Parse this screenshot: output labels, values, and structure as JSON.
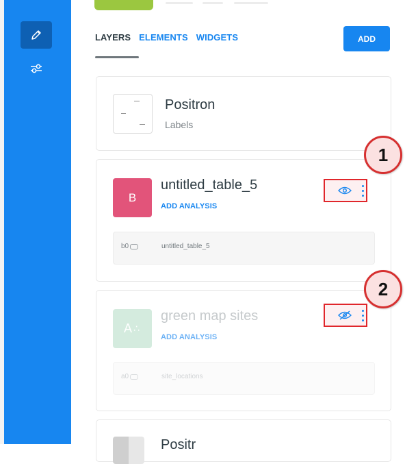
{
  "tabs": {
    "layers": "LAYERS",
    "elements": "ELEMENTS",
    "widgets": "WIDGETS",
    "add_label": "ADD"
  },
  "basemap": {
    "title": "Positron",
    "subtitle": "Labels"
  },
  "layers": [
    {
      "letter": "B",
      "name": "untitled_table_5",
      "add_analysis": "ADD ANALYSIS",
      "node_id": "b0",
      "source": "untitled_table_5",
      "visible": true,
      "color": "#e2547a"
    },
    {
      "letter": "A",
      "name": "green map sites",
      "add_analysis": "ADD ANALYSIS",
      "node_id": "a0",
      "source": "site_locations",
      "visible": false,
      "color": "#d4ebde"
    }
  ],
  "partial_layer": {
    "title": "Positr"
  },
  "callouts": [
    "1",
    "2"
  ],
  "icons": [
    "pencil-icon",
    "sliders-icon",
    "eye-icon",
    "eye-off-icon",
    "kebab-menu-icon"
  ],
  "colors": {
    "sidebar": "#1786f0",
    "accent": "#1786f0",
    "highlight": "#e0262b"
  }
}
